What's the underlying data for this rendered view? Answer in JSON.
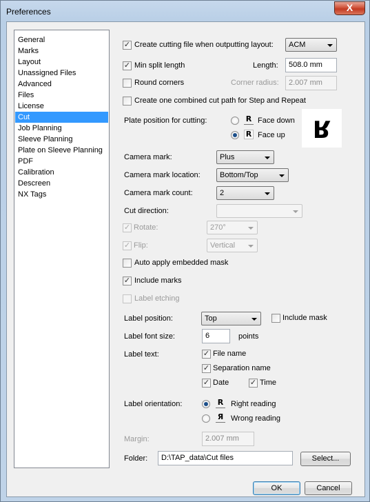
{
  "window": {
    "title": "Preferences",
    "close_label": "X"
  },
  "sidebar": {
    "items": [
      {
        "label": "General"
      },
      {
        "label": "Marks"
      },
      {
        "label": "Layout"
      },
      {
        "label": "Unassigned Files"
      },
      {
        "label": "Advanced"
      },
      {
        "label": "Files"
      },
      {
        "label": "License"
      },
      {
        "label": "Cut"
      },
      {
        "label": "Job Planning"
      },
      {
        "label": "Sleeve Planning"
      },
      {
        "label": "Plate on Sleeve Planning"
      },
      {
        "label": "PDF"
      },
      {
        "label": "Calibration"
      },
      {
        "label": "Descreen"
      },
      {
        "label": "NX Tags"
      }
    ],
    "selected": "Cut"
  },
  "cut": {
    "create_cutting_file": {
      "label": "Create cutting file when outputting layout:",
      "checked": true
    },
    "format": {
      "value": "ACM"
    },
    "min_split": {
      "label": "Min split length",
      "checked": true
    },
    "length": {
      "label": "Length:",
      "value": "508.0 mm"
    },
    "round_corners": {
      "label": "Round corners",
      "checked": false
    },
    "corner_radius": {
      "label": "Corner radius:",
      "value": "2.007 mm"
    },
    "combined_cut": {
      "label": "Create one combined cut path for Step and Repeat",
      "checked": false
    },
    "plate_position": {
      "label": "Plate position for cutting:",
      "face_down": {
        "label": "Face down",
        "glyph": "R",
        "selected": false
      },
      "face_up": {
        "label": "Face up",
        "glyph": "R",
        "selected": true
      },
      "preview_glyph": "R"
    },
    "camera_mark": {
      "label": "Camera mark:",
      "value": "Plus"
    },
    "camera_mark_location": {
      "label": "Camera mark location:",
      "value": "Bottom/Top"
    },
    "camera_mark_count": {
      "label": "Camera mark count:",
      "value": "2"
    },
    "cut_direction": {
      "label": "Cut direction:",
      "value": ""
    },
    "rotate": {
      "label": "Rotate:",
      "checked": true,
      "value": "270°"
    },
    "flip": {
      "label": "Flip:",
      "checked": true,
      "value": "Vertical"
    },
    "auto_apply_mask": {
      "label": "Auto apply embedded mask",
      "checked": false
    },
    "include_marks": {
      "label": "Include marks",
      "checked": true
    },
    "label_etching": {
      "label": "Label etching",
      "checked": false
    },
    "label_position": {
      "label": "Label position:",
      "value": "Top"
    },
    "include_mask": {
      "label": "Include mask",
      "checked": false
    },
    "label_font_size": {
      "label": "Label font size:",
      "value": "6",
      "unit": "points"
    },
    "label_text": {
      "label": "Label text:",
      "file_name": {
        "label": "File name",
        "checked": true
      },
      "separation_name": {
        "label": "Separation name",
        "checked": true
      },
      "date": {
        "label": "Date",
        "checked": true
      },
      "time": {
        "label": "Time",
        "checked": true
      }
    },
    "label_orientation": {
      "label": "Label orientation:",
      "right_reading": {
        "label": "Right reading",
        "glyph": "R",
        "selected": true
      },
      "wrong_reading": {
        "label": "Wrong reading",
        "glyph": "Я",
        "selected": false
      }
    },
    "margin": {
      "label": "Margin:",
      "value": "2.007 mm"
    },
    "folder": {
      "label": "Folder:",
      "value": "D:\\TAP_data\\Cut files",
      "button": "Select..."
    }
  },
  "footer": {
    "ok": "OK",
    "cancel": "Cancel"
  },
  "check_glyph": "✓"
}
